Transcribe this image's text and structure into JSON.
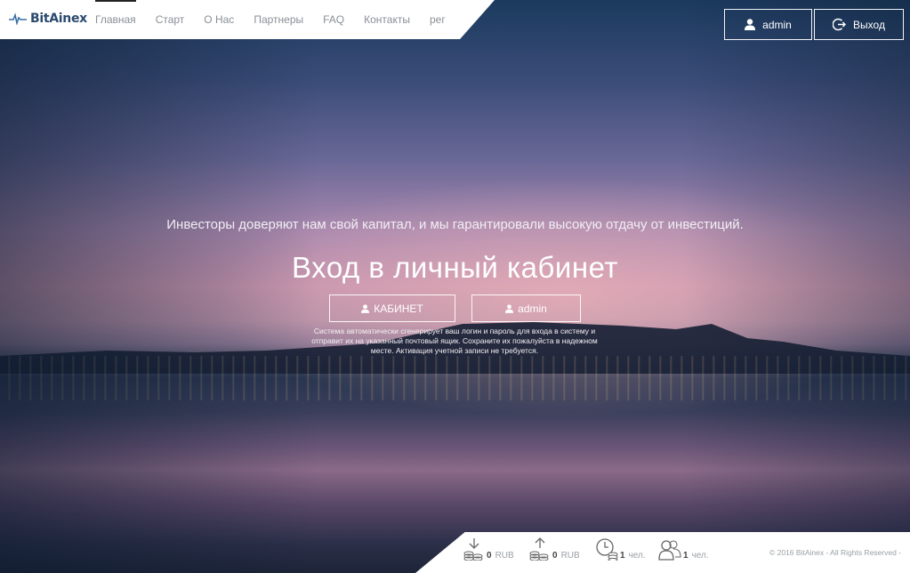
{
  "brand": {
    "name": "BitAinex"
  },
  "nav": {
    "items": [
      {
        "label": "Главная"
      },
      {
        "label": "Старт"
      },
      {
        "label": "О Нас"
      },
      {
        "label": "Партнеры"
      },
      {
        "label": "FAQ"
      },
      {
        "label": "Контакты"
      },
      {
        "label": "рег"
      }
    ]
  },
  "header_buttons": {
    "user_label": "admin",
    "user_icon": "user-icon",
    "logout_label": "Выход",
    "logout_icon": "logout-icon"
  },
  "hero": {
    "tagline": "Инвесторы доверяют нам свой капитал, и мы гарантировали высокую отдачу от инвестиций.",
    "title": "Вход в личный кабинет",
    "cabinet_button": "КАБИНЕТ",
    "admin_button": "admin",
    "notice_line1": "Система автоматически сгенерирует ваш логин и пароль для входа в систему и",
    "notice_line2": "отправит их на указанный почтовый ящик. Сохраните их пожалуйста в надежном",
    "notice_line3": "месте. Активация учетной записи не требуется."
  },
  "footer": {
    "deposits": {
      "value": "0",
      "unit": "RUB",
      "icon": "download-coins-icon"
    },
    "withdrawals": {
      "value": "0",
      "unit": "RUB",
      "icon": "upload-coins-icon"
    },
    "online": {
      "value": "1",
      "unit": "чел.",
      "icon": "clock-coins-icon"
    },
    "users": {
      "value": "1",
      "unit": "чел.",
      "icon": "users-icon"
    },
    "copyright": "© 2016 BitAinex - All Rights Reserved -"
  },
  "colors": {
    "brand": "#2a4a6e",
    "nav_text": "#8a8f96",
    "white": "#ffffff"
  }
}
